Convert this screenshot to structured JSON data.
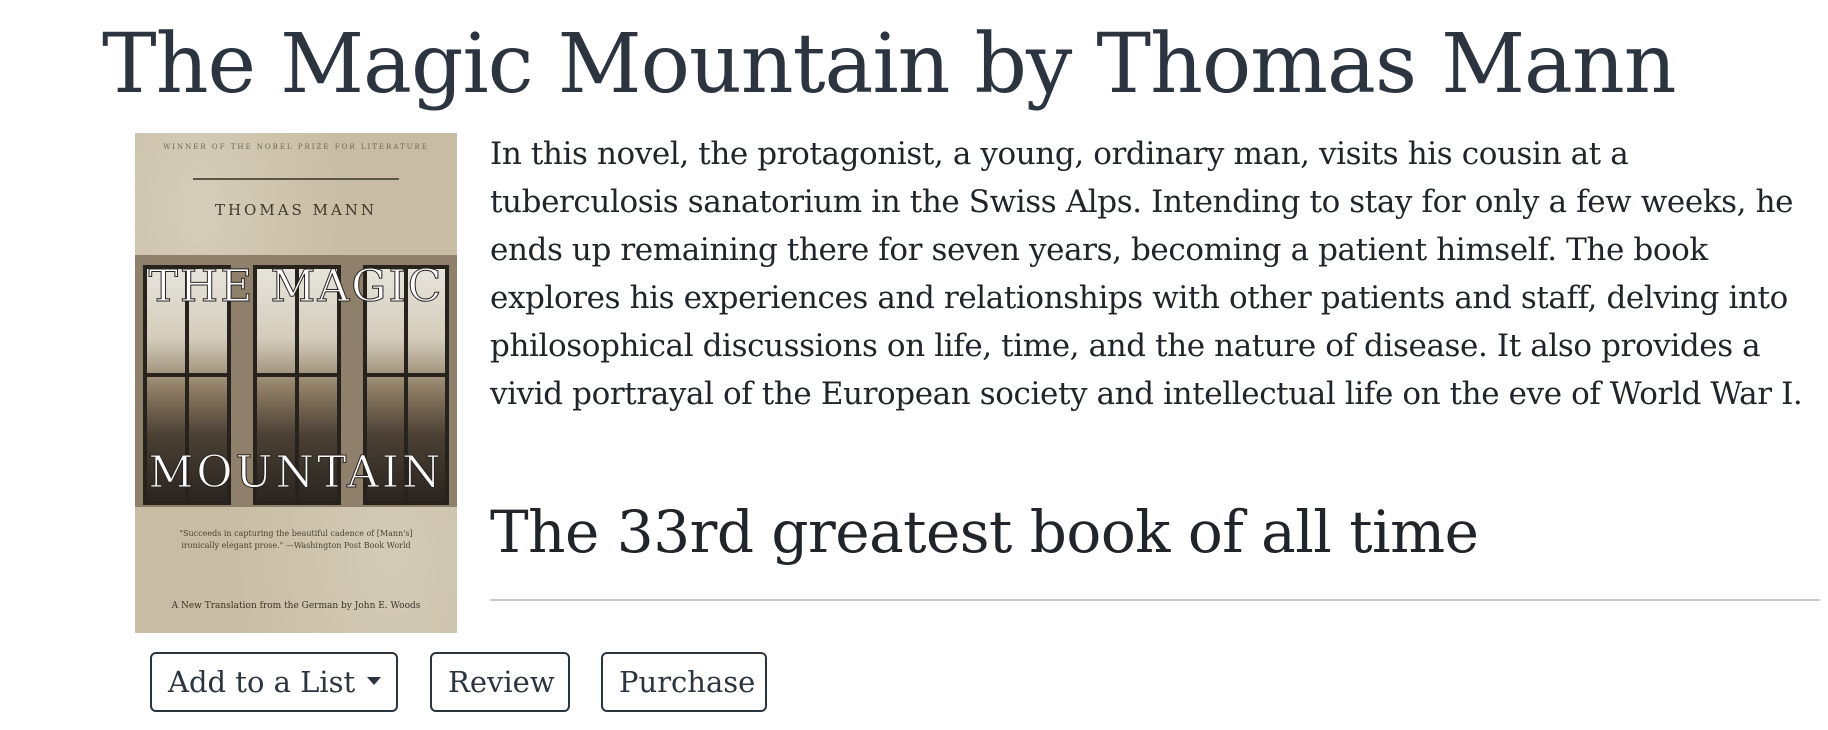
{
  "page": {
    "title": "The Magic Mountain by Thomas Mann"
  },
  "cover": {
    "award_line": "Winner of the Nobel Prize for Literature",
    "author": "THOMAS MANN",
    "title_line_1": "THE MAGIC",
    "title_line_2": "MOUNTAIN",
    "quote": "\"Succeeds in capturing the beautiful cadence of [Mann's] ironically elegant prose.\" —Washington Post Book World",
    "translation": "A New Translation from the German by John E. Woods"
  },
  "book": {
    "description": "In this novel, the protagonist, a young, ordinary man, visits his cousin at a tuberculosis sanatorium in the Swiss Alps. Intending to stay for only a few weeks, he ends up remaining there for seven years, becoming a patient himself. The book explores his experiences and relationships with other patients and staff, delving into philosophical discussions on life, time, and the nature of disease. It also provides a vivid portrayal of the European society and intellectual life on the eve of World War I.",
    "rank_text": "The 33rd greatest book of all time"
  },
  "actions": {
    "add_to_list_label": "Add to a List",
    "review_label": "Review",
    "purchase_label": "Purchase"
  },
  "icons": {
    "dropdown": "caret-down-icon"
  },
  "colors": {
    "title": "#2c3440",
    "text": "#212529",
    "button_border": "#2c3440",
    "divider": "#c9c9c9"
  }
}
